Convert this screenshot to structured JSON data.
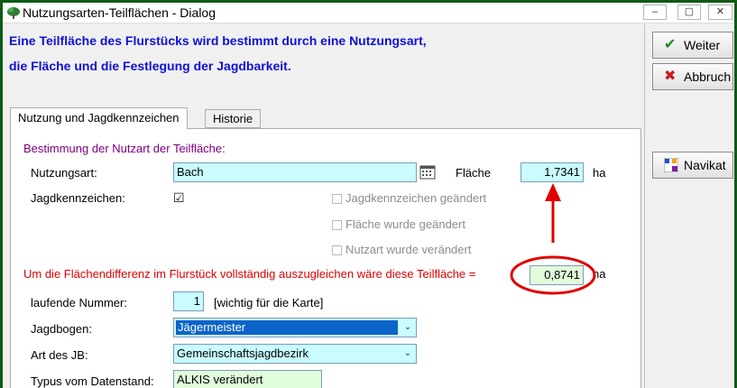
{
  "window": {
    "title": "Nutzungsarten-Teilflächen - Dialog",
    "minimize_glyph": "–",
    "maximize_glyph": "▢",
    "close_glyph": "✕",
    "app_icon": "tree-icon"
  },
  "intro": {
    "line1": "Eine Teilfläche des Flurstücks wird bestimmt durch eine Nutzungsart,",
    "line2": "die Fläche und die Festlegung der Jagdbarkeit."
  },
  "tabs": [
    {
      "label": "Nutzung und Jagdkennzeichen",
      "active": true
    },
    {
      "label": "Historie",
      "active": false
    }
  ],
  "form": {
    "section_title": "Bestimmung der Nutzart der Teilfläche:",
    "nutzungsart_label": "Nutzungsart:",
    "nutzungsart_value": "Bach",
    "flaeche_label": "Fläche",
    "flaeche_value": "1,7341",
    "flaeche_unit": "ha",
    "jagdkennzeichen_label": "Jagdkennzeichen:",
    "jagdkennzeichen_checked": true,
    "check_glyph": "☑",
    "cb_jagd_changed": "Jagdkennzeichen geändert",
    "cb_flaeche_changed": "Fläche wurde geändert",
    "cb_nutzart_changed": "Nutzart wurde verändert",
    "diff_text": "Um die Flächendifferenz im Flurstück vollständig auszugleichen wäre diese Teilfläche =",
    "diff_value": "0,8741",
    "diff_unit": "ha",
    "lfd_label": "laufende Nummer:",
    "lfd_value": "1",
    "lfd_hint": "[wichtig für die Karte]",
    "jagdbogen_label": "Jagdbogen:",
    "jagdbogen_value": "Jägermeister",
    "art_jb_label": "Art des JB:",
    "art_jb_value": "Gemeinschaftsjagdbezirk",
    "typus_label": "Typus vom Datenstand:",
    "typus_value": "ALKIS verändert",
    "dropdown_glyph": "⌄"
  },
  "buttons": {
    "weiter": "Weiter",
    "abbruch": "Abbruch",
    "navikat": "Navikat"
  },
  "colors": {
    "intro_text": "#1010d8",
    "section_title": "#800080",
    "warning_text": "#e00000",
    "annotation": "#e00000",
    "field_cyan": "#c9fbff",
    "field_green": "#e1fcdb",
    "frame": "#0d5a14"
  }
}
